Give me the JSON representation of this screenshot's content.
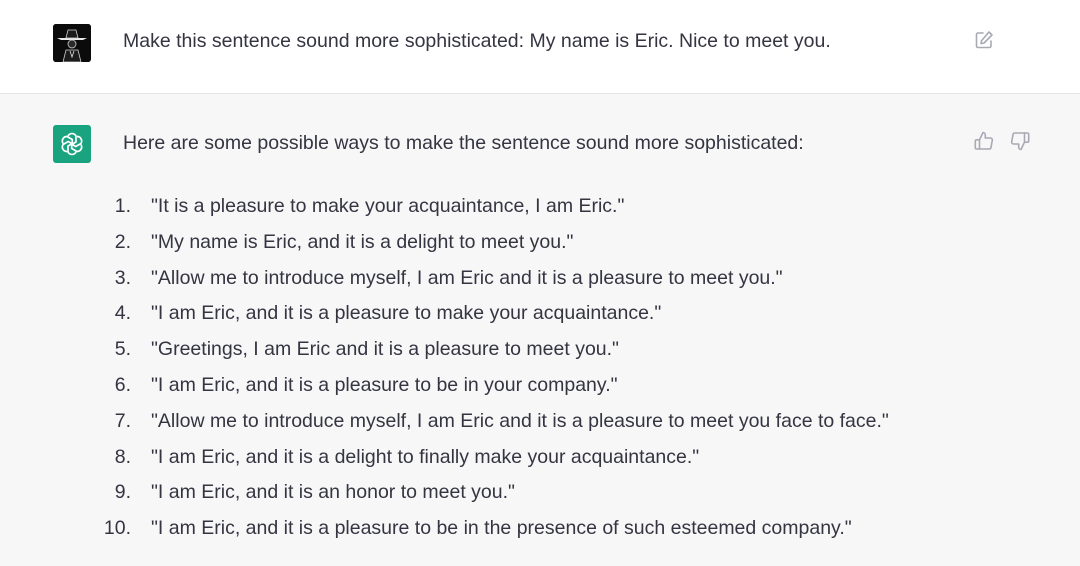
{
  "conversation": {
    "user_message": {
      "text": "Make this sentence sound more sophisticated: My name is Eric. Nice to meet you.",
      "avatar_icon": "hooded-figure-avatar",
      "edit_icon": "edit-icon"
    },
    "assistant_message": {
      "intro": "Here are some possible ways to make the sentence sound more sophisticated:",
      "avatar_icon": "openai-logo-icon",
      "avatar_color": "#19a37f",
      "feedback_icons": [
        "thumbs-up-icon",
        "thumbs-down-icon"
      ],
      "items": [
        {
          "num": "1.",
          "text": "\"It is a pleasure to make your acquaintance, I am Eric.\""
        },
        {
          "num": "2.",
          "text": "\"My name is Eric, and it is a delight to meet you.\""
        },
        {
          "num": "3.",
          "text": "\"Allow me to introduce myself, I am Eric and it is a pleasure to meet you.\""
        },
        {
          "num": "4.",
          "text": "\"I am Eric, and it is a pleasure to make your acquaintance.\""
        },
        {
          "num": "5.",
          "text": "\"Greetings, I am Eric and it is a pleasure to meet you.\""
        },
        {
          "num": "6.",
          "text": "\"I am Eric, and it is a pleasure to be in your company.\""
        },
        {
          "num": "7.",
          "text": "\"Allow me to introduce myself, I am Eric and it is a pleasure to meet you face to face.\""
        },
        {
          "num": "8.",
          "text": "\"I am Eric, and it is a delight to finally make your acquaintance.\""
        },
        {
          "num": "9.",
          "text": "\"I am Eric, and it is an honor to meet you.\""
        },
        {
          "num": "10.",
          "text": "\"I am Eric, and it is a pleasure to be in the presence of such esteemed company.\""
        }
      ]
    }
  },
  "colors": {
    "user_background": "#ffffff",
    "assistant_background": "#f7f7f8",
    "text": "#343541",
    "icon": "#a9a9b3"
  }
}
